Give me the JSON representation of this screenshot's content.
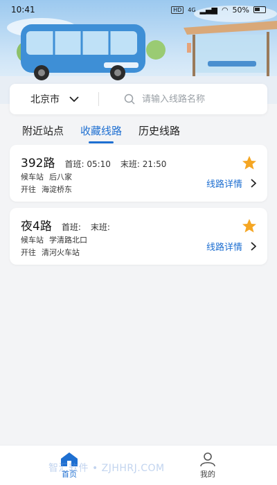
{
  "status": {
    "time": "10:41",
    "hd": "HD",
    "net": "4G",
    "battery": "50%"
  },
  "city": {
    "name": "北京市"
  },
  "search": {
    "placeholder": "请输入线路名称"
  },
  "tabs": [
    {
      "label": "附近站点",
      "active": false
    },
    {
      "label": "收藏线路",
      "active": true
    },
    {
      "label": "历史线路",
      "active": false
    }
  ],
  "routes": [
    {
      "name": "392路",
      "first_label": "首班:",
      "first_time": "05:10",
      "last_label": "末班:",
      "last_time": "21:50",
      "wait_label": "候车站",
      "wait_stop": "后八家",
      "to_label": "开往",
      "to_stop": "海淀桥东",
      "detail_label": "线路详情"
    },
    {
      "name": "夜4路",
      "first_label": "首班:",
      "first_time": "",
      "last_label": "末班:",
      "last_time": "",
      "wait_label": "候车站",
      "wait_stop": "学清路北口",
      "to_label": "开往",
      "to_stop": "清河火车站",
      "detail_label": "线路详情"
    }
  ],
  "nav": [
    {
      "label": "首页",
      "icon": "home-icon",
      "active": true
    },
    {
      "label": "我的",
      "icon": "user-icon",
      "active": false
    }
  ],
  "watermark": "智汇软件 • ZJHHRJ.COM",
  "colors": {
    "accent": "#1e6fd1",
    "star": "#f5a623",
    "background": "#f3f4f6"
  }
}
